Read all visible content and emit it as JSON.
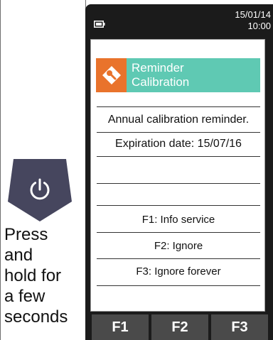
{
  "left_panel": {
    "press_instruction_lines": [
      "Press",
      "and",
      "hold for",
      "a few",
      "seconds"
    ],
    "power_icon": "power-icon"
  },
  "status_bar": {
    "battery_icon": "battery-icon",
    "date": "15/01/14",
    "time": "10:00"
  },
  "dialog": {
    "icon": "wrench-icon",
    "title_line1": "Reminder",
    "title_line2": "Calibration",
    "message": "Annual calibration reminder.",
    "expiration": "Expiration date: 15/07/16",
    "options": [
      "F1: Info service",
      "F2: Ignore",
      "F3: Ignore forever"
    ]
  },
  "function_keys": [
    "F1",
    "F2",
    "F3"
  ],
  "colors": {
    "header_bg": "#5fc9b3",
    "icon_bg": "#e9732c",
    "device_bg": "#1b1b1b",
    "function_key_bg": "#4a4a4a",
    "power_button_bg": "#46465e"
  }
}
